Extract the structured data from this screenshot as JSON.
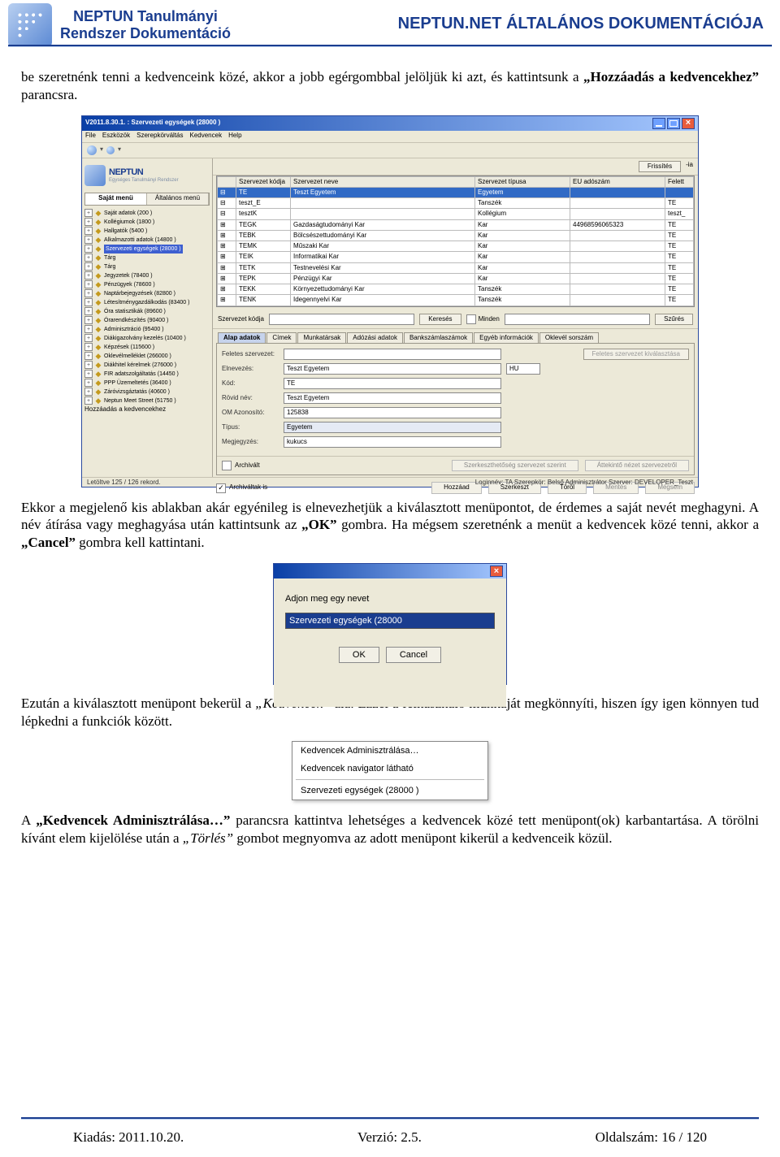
{
  "header": {
    "left_line1": "NEPTUN Tanulmányi",
    "left_line2": "Rendszer Dokumentáció",
    "right": "NEPTUN.NET ÁLTALÁNOS DOKUMENTÁCIÓJA"
  },
  "para1_a": "be szeretnénk tenni a kedvenceink közé, akkor a jobb egérgombbal jelöljük ki azt, és kattintsunk a ",
  "para1_b": "„Hozzáadás a kedvencekhez”",
  "para1_c": " parancsra.",
  "shot1": {
    "title": "V2011.8.30.1. : Szervezeti egységek (28000  )",
    "menu": [
      "File",
      "Eszközök",
      "Szerepkörváltás",
      "Kedvencek",
      "Help"
    ],
    "brand_t1": "NEPTUN",
    "brand_t2": "Egységes Tanulmányi Rendszer",
    "side_tabs": [
      "Saját menü",
      "Általános menü"
    ],
    "tree": [
      "Saját adatok (200  )",
      "Kollégiumok (1800  )",
      "Hallgatók (5400  )",
      "Alkalmazotti adatok (14800  )",
      "Szervezeti egységek (28000  )",
      "Tárg",
      "Tárg",
      "Jegyzetek (78400  )",
      "Pénzügyek (78600  )",
      "Naptárbejegyzések (82800  )",
      "Létesítménygazdálkodás (83400  )",
      "Óra statisztikák (89600  )",
      "Órarendkészítés (90400  )",
      "Adminisztráció (95400  )",
      "Diákigazolvány kezelés (10400  )",
      "Képzések (115600  )",
      "Oklevélmelléklet (266000  )",
      "Diákhitel kérelmek (276000  )",
      "FIR adatszolgáltatás (14450  )",
      "PPP Üzemeltetés (36400  )",
      "Záróvizsgáztatás (40600  )",
      "Neptun Meet Street (51750  )"
    ],
    "tree_ctx": "Hozzáadás a kedvencekhez",
    "toprow": {
      "btn1": "Frissítés",
      "arrow": "-ia"
    },
    "grid": {
      "headers": [
        "",
        "Szervezet kódja",
        "Szervezet neve",
        "Szervezet típusa",
        "EU adószám",
        "Felett"
      ],
      "rows": [
        [
          "",
          "TE",
          "Teszt Egyetem",
          "Egyetem",
          "",
          ""
        ],
        [
          "",
          "teszt_E",
          "",
          "Tanszék",
          "",
          "TE"
        ],
        [
          "",
          "tesztK",
          "",
          "Kollégium",
          "",
          "teszt_"
        ],
        [
          "",
          "TEGK",
          "Gazdaságtudományi Kar",
          "Kar",
          "44968596065323",
          "TE"
        ],
        [
          "",
          "TEBK",
          "Bölcsészettudományi Kar",
          "Kar",
          "",
          "TE"
        ],
        [
          "",
          "TEMK",
          "Műszaki Kar",
          "Kar",
          "",
          "TE"
        ],
        [
          "",
          "TEIK",
          "Informatikai Kar",
          "Kar",
          "",
          "TE"
        ],
        [
          "",
          "TETK",
          "Testnevelési Kar",
          "Kar",
          "",
          "TE"
        ],
        [
          "",
          "TEPK",
          "Pénzügyi Kar",
          "Kar",
          "",
          "TE"
        ],
        [
          "",
          "TEKK",
          "Környezettudományi Kar",
          "Tanszék",
          "",
          "TE"
        ],
        [
          "",
          "TENK",
          "Idegennyelvi Kar",
          "Tanszék",
          "",
          "TE"
        ]
      ]
    },
    "search": {
      "label": "Szervezet kódja",
      "btn1": "Keresés",
      "chk": "Minden",
      "btn2": "Szűrés"
    },
    "tabs2": [
      "Alap adatok",
      "Címek",
      "Munkatársak",
      "Adózási adatok",
      "Bankszámlaszámok",
      "Egyéb információk",
      "Oklevél sorszám"
    ],
    "form": {
      "headbtn": "Feletes szervezet kiválasztása",
      "rows": [
        [
          "Feletes szervezet:",
          ""
        ],
        [
          "Elnevezés:",
          "Teszt Egyetem"
        ],
        [
          "Kód:",
          "TE"
        ],
        [
          "Rövid név:",
          "Teszt Egyetem"
        ],
        [
          "OM Azonosító:",
          "125838"
        ],
        [
          "Típus:",
          "Egyetem"
        ],
        [
          "Megjegyzés:",
          "kukucs"
        ]
      ],
      "hu": "HU",
      "archlab": "Archivált",
      "szbtn1": "Szerkeszthetőség szervezet szerint",
      "szbtn2": "Áttekintő nézet szervezetről",
      "archall": "Archiváltak is",
      "bbtns": [
        "Hozzáad",
        "Szerkeszt",
        "Töröl",
        "Mentés",
        "Mégsem"
      ]
    },
    "status": {
      "left": "Letöltve 125 / 126 rekord.",
      "right": "Loginnév: TA  Szerepkör: Belső Adminisztrátor  Szerver: DEVELOPER_Teszt"
    }
  },
  "para2_a": "Ekkor a megjelenő kis ablakban akár egyénileg is elnevezhetjük a kiválasztott menüpontot, de érdemes a saját nevét meghagyni. A név átírása vagy meghagyása után kattintsunk az ",
  "para2_b": "„OK”",
  "para2_c": " gombra. Ha mégsem szeretnénk a menüt a kedvencek közé tenni, akkor a ",
  "para2_d": "„Cancel”",
  "para2_e": " gombra kell kattintani.",
  "shot2": {
    "prompt": "Adjon meg egy nevet",
    "value": "Szervezeti egységek (28000",
    "ok": "OK",
    "cancel": "Cancel"
  },
  "para3_a": "Ezután a kiválasztott menüpont bekerül a ",
  "para3_b": "„Kedvencek”",
  "para3_c": " alá. Ezzel a felhasználó munkáját megkönnyíti, hiszen így igen könnyen tud lépkedni a funkciók között.",
  "shot3": {
    "i1": "Kedvencek Adminisztrálása…",
    "i2": "Kedvencek navigator látható",
    "i3": "Szervezeti egységek (28000  )"
  },
  "para4_a": "A ",
  "para4_b": "„Kedvencek Adminisztrálása…”",
  "para4_c": " parancsra kattintva lehetséges a kedvencek közé tett menüpont(ok) karbantartása. A törölni kívánt elem kijelölése után a ",
  "para4_d": "„Törlés”",
  "para4_e": " gombot megnyomva az adott menüpont kikerül a kedvenceik közül.",
  "footer": {
    "k": "Kiadás: 2011.10.20.",
    "v": "Verzió: 2.5.",
    "o": "Oldalszám: 16 / 120"
  }
}
